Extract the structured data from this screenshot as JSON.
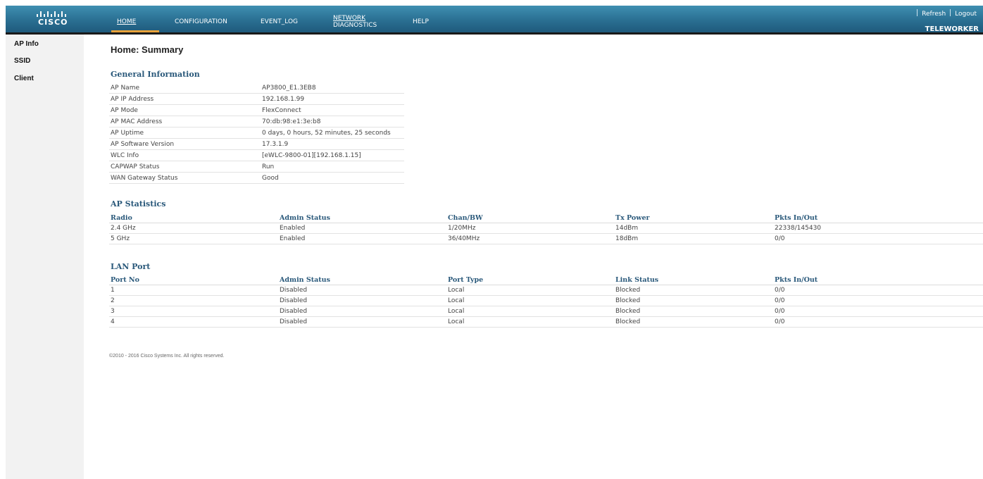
{
  "brand": {
    "logo_text": "CISCO"
  },
  "nav": {
    "home": "HOME",
    "configuration": "CONFIGURATION",
    "event_log": "EVENT_LOG",
    "network_line1": "NETWORK",
    "network_line2": "DIAGNOSTICS",
    "help": "HELP"
  },
  "top_links": {
    "refresh": "Refresh",
    "logout": "Logout",
    "mode": "TELEWORKER"
  },
  "sidebar": {
    "items": [
      {
        "label": "AP Info"
      },
      {
        "label": "SSID"
      },
      {
        "label": "Client"
      }
    ]
  },
  "page": {
    "title": "Home: Summary"
  },
  "general_info": {
    "title": "General Information",
    "rows": [
      {
        "key": "AP Name",
        "value": "AP3800_E1.3EB8"
      },
      {
        "key": "AP IP Address",
        "value": "192.168.1.99"
      },
      {
        "key": "AP Mode",
        "value": "FlexConnect"
      },
      {
        "key": "AP MAC Address",
        "value": "70:db:98:e1:3e:b8"
      },
      {
        "key": "AP Uptime",
        "value": "0 days, 0 hours, 52 minutes, 25 seconds"
      },
      {
        "key": "AP Software Version",
        "value": "17.3.1.9"
      },
      {
        "key": "WLC Info",
        "value": "[eWLC-9800-01][192.168.1.15]"
      },
      {
        "key": "CAPWAP Status",
        "value": "Run"
      },
      {
        "key": "WAN Gateway Status",
        "value": "Good"
      }
    ]
  },
  "ap_statistics": {
    "title": "AP Statistics",
    "headers": [
      "Radio",
      "Admin Status",
      "Chan/BW",
      "Tx Power",
      "Pkts In/Out"
    ],
    "rows": [
      [
        "2.4 GHz",
        "Enabled",
        "1/20MHz",
        "14dBm",
        "22338/145430"
      ],
      [
        "5 GHz",
        "Enabled",
        "36/40MHz",
        "18dBm",
        "0/0"
      ]
    ]
  },
  "lan_port": {
    "title": "LAN Port",
    "headers": [
      "Port No",
      "Admin Status",
      "Port Type",
      "Link Status",
      "Pkts In/Out"
    ],
    "rows": [
      [
        "1",
        "Disabled",
        "Local",
        "Blocked",
        "0/0"
      ],
      [
        "2",
        "Disabled",
        "Local",
        "Blocked",
        "0/0"
      ],
      [
        "3",
        "Disabled",
        "Local",
        "Blocked",
        "0/0"
      ],
      [
        "4",
        "Disabled",
        "Local",
        "Blocked",
        "0/0"
      ]
    ]
  },
  "footer": {
    "copyright": "©2010 - 2016 Cisco Systems Inc. All rights reserved."
  },
  "colors": {
    "header_top": "#3f8fb1",
    "header_bottom": "#1f5a7c",
    "active_tab_accent": "#e8a23a",
    "section_title": "#29587a",
    "sidebar_bg": "#f2f2f2"
  }
}
